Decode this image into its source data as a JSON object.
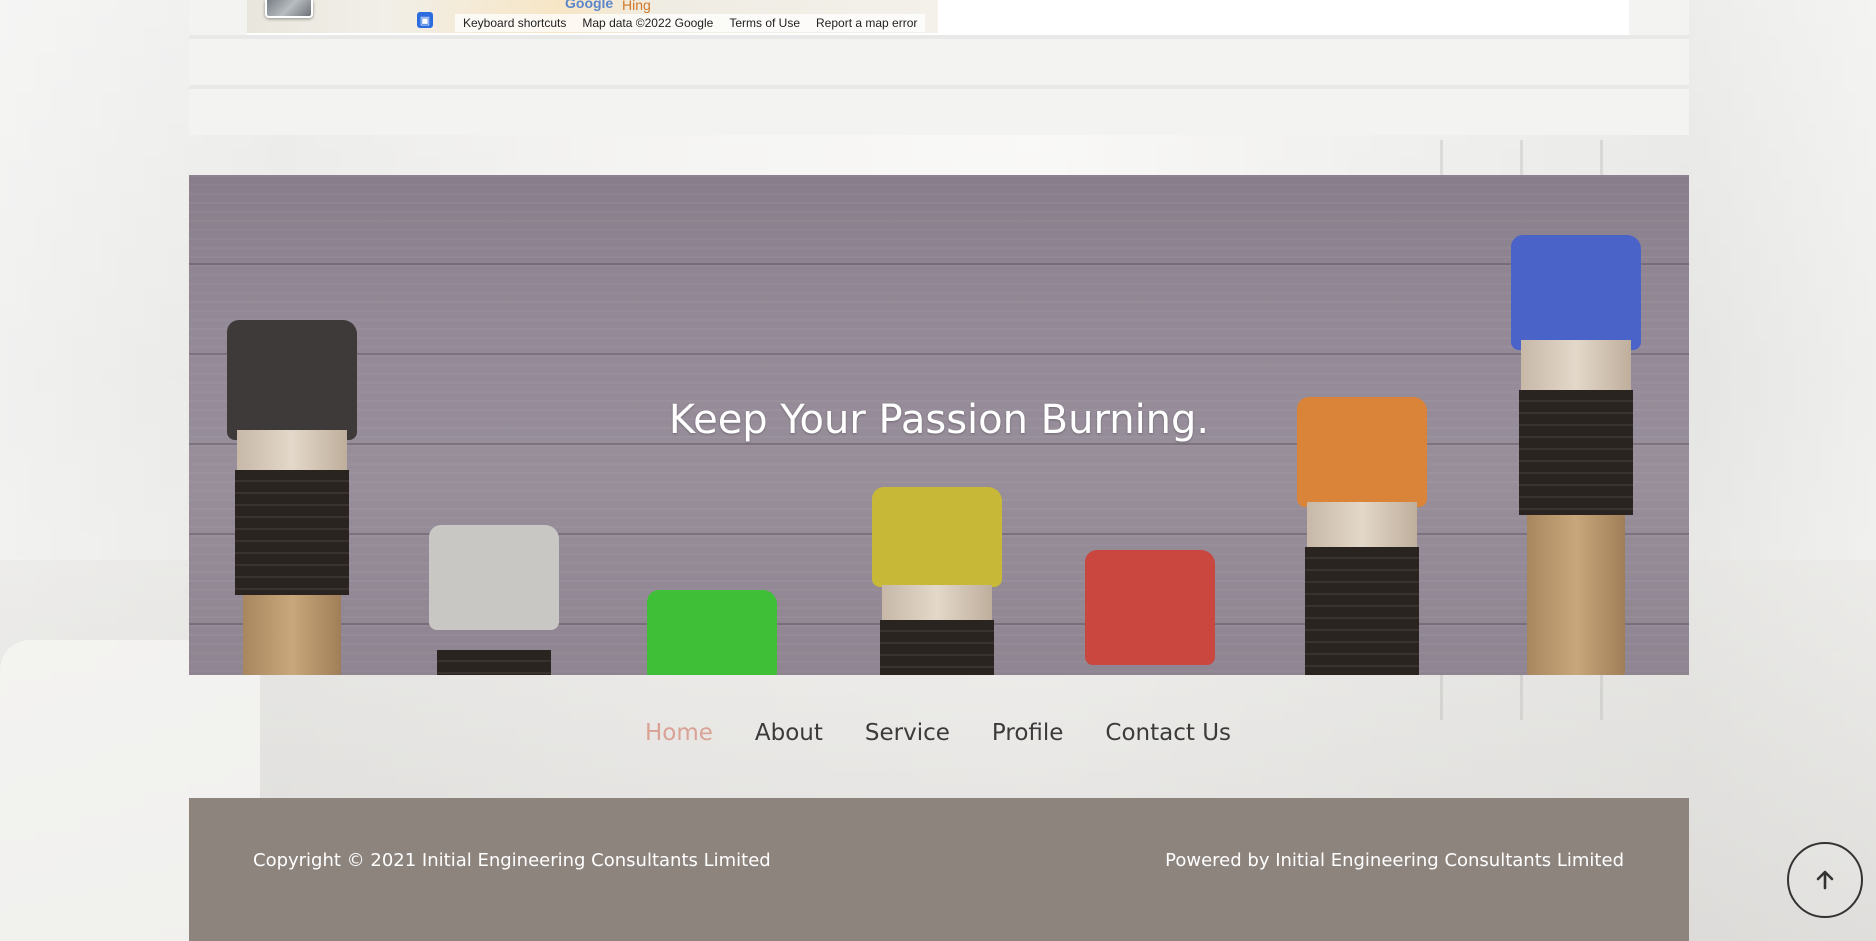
{
  "map": {
    "logo_text": "Google",
    "place_label": "Hing",
    "attribution": {
      "keyboard_shortcuts": "Keyboard shortcuts",
      "map_data": "Map data ©2022 Google",
      "terms": "Terms of Use",
      "report": "Report a map error"
    }
  },
  "hero": {
    "title": "Keep Your Passion Burning."
  },
  "nav": {
    "items": [
      {
        "label": "Home",
        "active": true
      },
      {
        "label": "About",
        "active": false
      },
      {
        "label": "Service",
        "active": false
      },
      {
        "label": "Profile",
        "active": false
      },
      {
        "label": "Contact Us",
        "active": false
      }
    ]
  },
  "footer": {
    "copyright": "Copyright © 2021 Initial Engineering Consultants Limited",
    "powered_by": "Powered by Initial Engineering Consultants Limited"
  },
  "back_to_top": {
    "icon": "arrow-up-icon"
  },
  "colors": {
    "nav_active": "#d9a294",
    "footer_bg": "#8e847e",
    "paint_black": "#3e3a3a",
    "paint_white": "#c9c7c4",
    "paint_green": "#3fbf37",
    "paint_yellow": "#c8b838",
    "paint_red": "#c9473f",
    "paint_orange": "#d98439",
    "paint_blue": "#4a63c8"
  }
}
